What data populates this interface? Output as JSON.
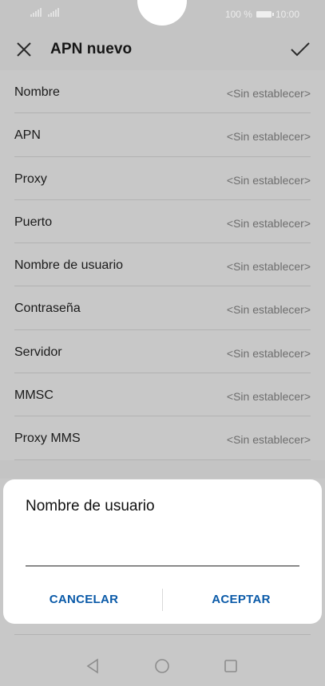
{
  "status_bar": {
    "battery_text": "100 %",
    "time": "10:00"
  },
  "app_bar": {
    "title": "APN nuevo",
    "close_icon": "close-icon",
    "confirm_icon": "check-icon"
  },
  "settings": {
    "rows": [
      {
        "label": "Nombre",
        "value": "<Sin establecer>"
      },
      {
        "label": "APN",
        "value": "<Sin establecer>"
      },
      {
        "label": "Proxy",
        "value": "<Sin establecer>"
      },
      {
        "label": "Puerto",
        "value": "<Sin establecer>"
      },
      {
        "label": "Nombre de usuario",
        "value": "<Sin establecer>"
      },
      {
        "label": "Contraseña",
        "value": "<Sin establecer>"
      },
      {
        "label": "Servidor",
        "value": "<Sin establecer>"
      },
      {
        "label": "MMSC",
        "value": "<Sin establecer>"
      },
      {
        "label": "Proxy MMS",
        "value": "<Sin establecer>"
      }
    ]
  },
  "dialog": {
    "title": "Nombre de usuario",
    "input_value": "",
    "cancel_label": "CANCELAR",
    "accept_label": "ACEPTAR"
  },
  "nav_bar": {
    "back_icon": "back-triangle-icon",
    "home_icon": "home-circle-icon",
    "recent_icon": "recent-square-icon"
  },
  "colors": {
    "accent": "#0a5aa8",
    "scrim": "#c4c4c4",
    "dialog_bg": "#ffffff"
  }
}
